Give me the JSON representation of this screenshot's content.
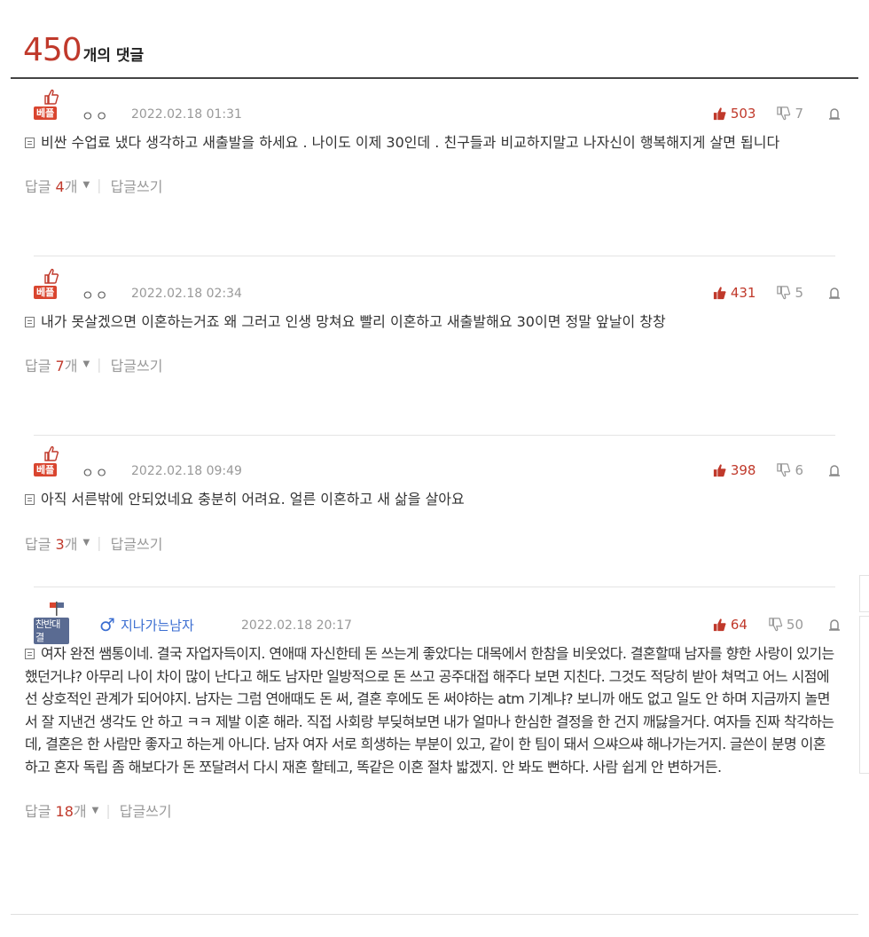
{
  "header": {
    "count": "450",
    "suffix": "개의 댓글"
  },
  "comments": [
    {
      "badge": "베플",
      "nick": "ㅇㅇ",
      "date": "2022.02.18 01:31",
      "up": "503",
      "down": "7",
      "text": "비싼 수업료 냈다 생각하고 새출발을 하세요 . 나이도 이제 30인데 . 친구들과 비교하지말고 나자신이 행복해지게 살면 됩니다",
      "reply_label": "답글",
      "reply_count": "4",
      "reply_unit": "개",
      "write_label": "답글쓰기"
    },
    {
      "badge": "베플",
      "nick": "ㅇㅇ",
      "date": "2022.02.18 02:34",
      "up": "431",
      "down": "5",
      "text": "내가 못살겠으면 이혼하는거죠 왜 그러고 인생 망쳐요 빨리 이혼하고 새출발해요 30이면 정말 앞날이 창창",
      "reply_label": "답글",
      "reply_count": "7",
      "reply_unit": "개",
      "write_label": "답글쓰기"
    },
    {
      "badge": "베플",
      "nick": "ㅇㅇ",
      "date": "2022.02.18 09:49",
      "up": "398",
      "down": "6",
      "text": "아직 서른밖에 안되었네요 충분히 어려요. 얼른 이혼하고 새 삶을 살아요",
      "reply_label": "답글",
      "reply_count": "3",
      "reply_unit": "개",
      "write_label": "답글쓰기"
    },
    {
      "badge": "찬반대결",
      "nick": "지나가는남자",
      "date": "2022.02.18 20:17",
      "up": "64",
      "down": "50",
      "text": "여자 완전 쌤통이네. 결국 자업자득이지. 연애때 자신한테 돈 쓰는게 좋았다는 대목에서 한참을 비웃었다. 결혼할때 남자를 향한 사랑이 있기는 했던거냐? 아무리 나이 차이 많이 난다고 해도 남자만 일방적으로 돈 쓰고 공주대접 해주다 보면 지친다. 그것도 적당히 받아 쳐먹고 어느 시점에선 상호적인 관계가 되어야지. 남자는 그럼 연애때도 돈 써, 결혼 후에도 돈 써야하는 atm 기계냐? 보니까 애도 없고 일도 안 하며 지금까지 놀면서 잘 지낸건 생각도 안 하고 ㅋㅋ 제발 이혼 해라. 직접 사회랑 부딪혀보면 내가 얼마나 한심한 결정을 한 건지 깨닳을거다. 여자들 진짜 착각하는데, 결혼은 한 사람만 좋자고 하는게 아니다. 남자 여자 서로 희생하는 부분이 있고, 같이 한 팀이 돼서 으쌰으쌰 해나가는거지. 글쓴이 분명 이혼하고 혼자 독립 좀 해보다가 돈 쪼달려서 다시 재혼 할테고, 똑같은 이혼 절차 밟겠지. 안 봐도 뻔하다. 사람 쉽게 안 변하거든.",
      "reply_label": "답글",
      "reply_count": "18",
      "reply_unit": "개",
      "write_label": "답글쓰기"
    }
  ],
  "colors": {
    "accent": "#c0392b",
    "badge_best": "#d9452f",
    "badge_vs": "#5a6b92"
  },
  "icons": [
    "thumbs-up-icon",
    "thumbs-down-icon",
    "report-icon",
    "document-icon",
    "flag-icon",
    "male-icon",
    "caret-down-icon"
  ]
}
